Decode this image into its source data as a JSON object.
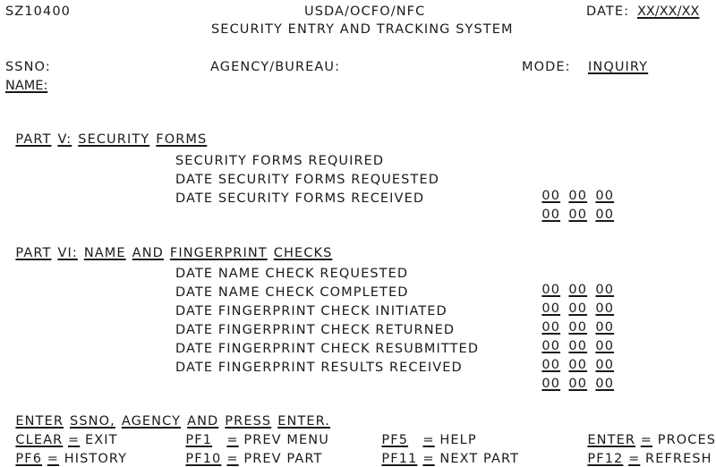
{
  "header": {
    "screen_id": "SZ10400",
    "org": "USDA/OCFO/NFC",
    "date_label": "DATE:",
    "date_value": "XX/XX/XX",
    "system_title": "SECURITY ENTRY AND TRACKING SYSTEM"
  },
  "fields": {
    "ssno_label": "SSNO:",
    "agency_label": "AGENCY/BUREAU:",
    "mode_label": "MODE:",
    "mode_value": "INQUIRY",
    "name_label": "NAME:"
  },
  "part5": {
    "heading_words": [
      "PART",
      "V:",
      "SECURITY",
      "FORMS"
    ],
    "rows": [
      {
        "label": "SECURITY FORMS REQUIRED",
        "date": null
      },
      {
        "label": "DATE SECURITY FORMS REQUESTED",
        "date": [
          "00",
          "00",
          "00"
        ]
      },
      {
        "label": "DATE SECURITY FORMS RECEIVED",
        "date": [
          "00",
          "00",
          "00"
        ]
      }
    ]
  },
  "part6": {
    "heading_words": [
      "PART",
      "VI:",
      "NAME",
      "AND",
      "FINGERPRINT",
      "CHECKS"
    ],
    "rows": [
      {
        "label": "DATE NAME CHECK REQUESTED",
        "date": [
          "00",
          "00",
          "00"
        ]
      },
      {
        "label": "DATE NAME CHECK COMPLETED",
        "date": [
          "00",
          "00",
          "00"
        ]
      },
      {
        "label": "DATE FINGERPRINT CHECK INITIATED",
        "date": [
          "00",
          "00",
          "00"
        ]
      },
      {
        "label": "DATE FINGERPRINT CHECK RETURNED",
        "date": [
          "00",
          "00",
          "00"
        ]
      },
      {
        "label": "DATE FINGERPRINT CHECK RESUBMITTED",
        "date": [
          "00",
          "00",
          "00"
        ]
      },
      {
        "label": "DATE FINGERPRINT RESULTS RECEIVED",
        "date": [
          "00",
          "00",
          "00"
        ]
      }
    ]
  },
  "footer": {
    "message_words": [
      "ENTER",
      "SSNO,",
      "AGENCY",
      "AND",
      "PRESS",
      "ENTER."
    ],
    "keys": [
      {
        "key": "CLEAR",
        "eq": "=",
        "action": "EXIT"
      },
      {
        "key": "PF1",
        "eq": "=",
        "action": "PREV MENU"
      },
      {
        "key": "PF5",
        "eq": "=",
        "action": "HELP"
      },
      {
        "key": "ENTER",
        "eq": "=",
        "action": "PROCESS"
      },
      {
        "key": "PF6",
        "eq": "=",
        "action": "HISTORY"
      },
      {
        "key": "PF10",
        "eq": "=",
        "action": "PREV PART"
      },
      {
        "key": "PF11",
        "eq": "=",
        "action": "NEXT PART"
      },
      {
        "key": "PF12",
        "eq": "=",
        "action": "REFRESH"
      }
    ]
  }
}
